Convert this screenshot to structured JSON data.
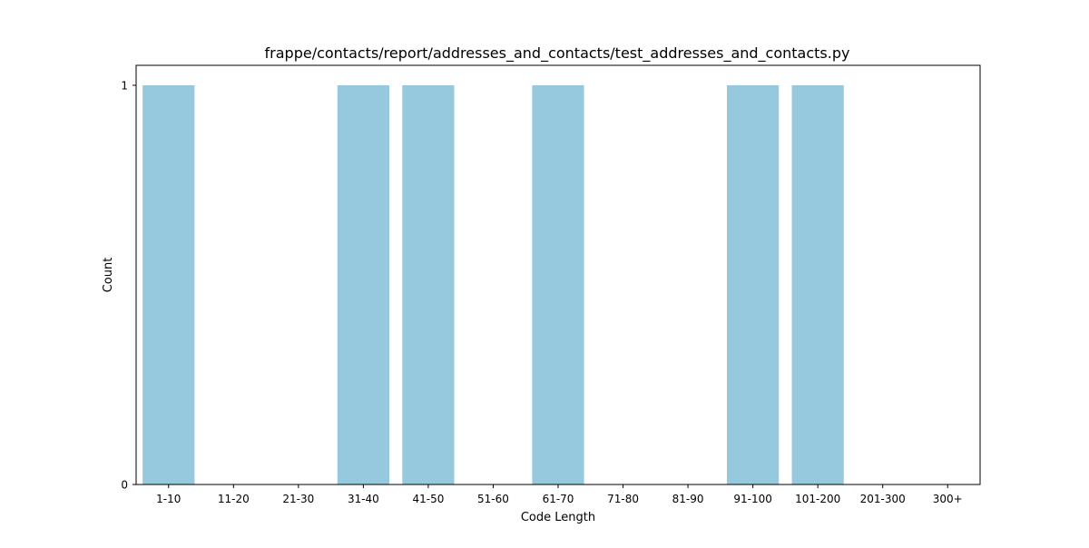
{
  "chart_data": {
    "type": "bar",
    "title": "frappe/contacts/report/addresses_and_contacts/test_addresses_and_contacts.py",
    "xlabel": "Code Length",
    "ylabel": "Count",
    "categories": [
      "1-10",
      "11-20",
      "21-30",
      "31-40",
      "41-50",
      "51-60",
      "61-70",
      "71-80",
      "81-90",
      "91-100",
      "101-200",
      "201-300",
      "300+"
    ],
    "values": [
      1,
      0,
      0,
      1,
      1,
      0,
      1,
      0,
      0,
      1,
      1,
      0,
      0
    ],
    "ylim": [
      0,
      1.05
    ],
    "yticks": [
      0,
      1
    ],
    "grid": false,
    "bar_color": "#96c9de"
  }
}
